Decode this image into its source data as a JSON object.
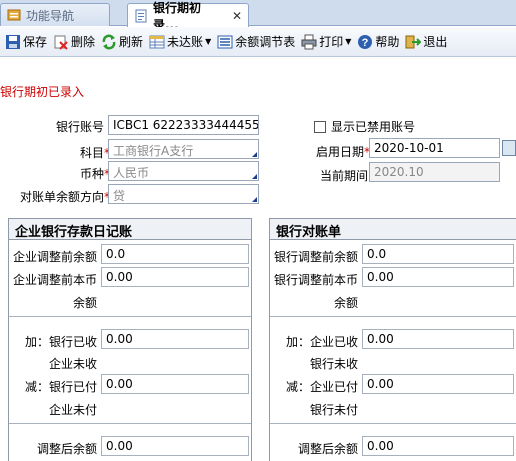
{
  "tabs": [
    {
      "label": "功能导航",
      "active": false
    },
    {
      "label": "银行期初录...",
      "active": true
    }
  ],
  "toolbar": {
    "save": "保存",
    "delete": "删除",
    "refresh": "刷新",
    "unreconciled": "未达账",
    "balance_sheet": "余额调节表",
    "print": "打印",
    "help": "帮助",
    "exit": "退出"
  },
  "subtitle": "银行期初已录入",
  "form": {
    "account_label": "银行账号",
    "account_value": "ICBC1 622233334444555",
    "subject_label": "科目",
    "subject_value": "工商银行A支行",
    "currency_label": "币种",
    "currency_value": "人民币",
    "direction_label": "对账单余额方向",
    "direction_value": "贷",
    "show_disabled_label": "显示已禁用账号",
    "start_date_label": "启用日期",
    "start_date_value": "2020-10-01",
    "current_period_label": "当前期间",
    "current_period_value": "2020.10"
  },
  "left_panel": {
    "title": "企业银行存款日记账",
    "before_balance_label": "企业调整前余额",
    "before_balance_value": "0.0",
    "before_currency_label1": "企业调整前本币",
    "before_currency_label2": "余额",
    "before_currency_value": "0.00",
    "add_label1": "加：银行已收",
    "add_label2": "企业未收",
    "add_value": "0.00",
    "sub_label1": "减：银行已付",
    "sub_label2": "企业未付",
    "sub_value": "0.00",
    "after_label": "调整后余额",
    "after_value": "0.00"
  },
  "right_panel": {
    "title": "银行对账单",
    "before_balance_label": "银行调整前余额",
    "before_balance_value": "0.0",
    "before_currency_label1": "银行调整前本币",
    "before_currency_label2": "余额",
    "before_currency_value": "0.00",
    "add_label1": "加：企业已收",
    "add_label2": "银行未收",
    "add_value": "0.00",
    "sub_label1": "减：企业已付",
    "sub_label2": "银行未付",
    "sub_value": "0.00",
    "after_label": "调整后余额",
    "after_value": "0.00"
  },
  "colors": {
    "required": "#cc0000",
    "tab_bar": "#cfdcee",
    "toolbar": "#e6ecf5"
  }
}
